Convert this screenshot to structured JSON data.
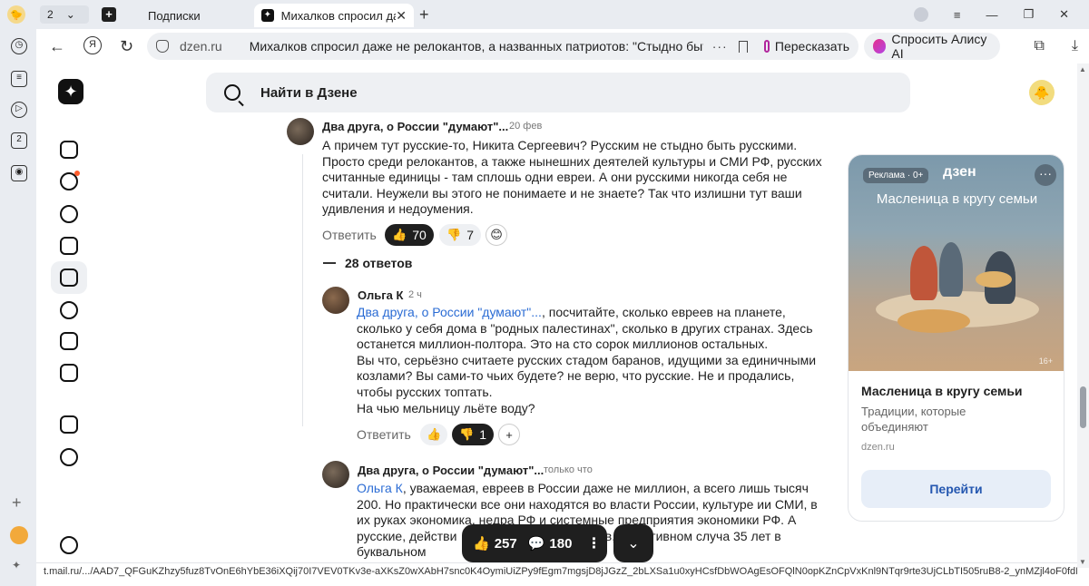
{
  "browser": {
    "tab_count": "2",
    "tabs": [
      {
        "label": "Подписки"
      },
      {
        "label": "Михалков спросил даже"
      }
    ],
    "address": {
      "domain": "dzen.ru",
      "page_title": "Михалков спросил даже не релокантов, а названных патриотов: \"Стыдно быт..."
    },
    "retell_label": "Пересказать",
    "alice_label": "Спросить Алису AI",
    "status_url": "t.mail.ru/.../AAD7_QFGuKZhzy5fuz8TvOnE6hYbE36iXQij70I7VEV0TKv3e-aXKsZ0wXAbH7snc0K4OymiUiZPy9fEgm7mgsjD8jJGzZ_2bLXSa1u0xyHCsfDbWOAgEsOFQlN0opKZnCpVxKnl9NTqr9rte3UjCLbTI505ruB8-2_ynMZjl4oF0fdI69jH7Vl..."
  },
  "header": {
    "search_label": "Найти в Дзене"
  },
  "comments": [
    {
      "author": "Два друга, о России \"думают\"...",
      "date": "20 фев",
      "text": "А причем тут русские-то, Никита Сергеевич? Русским не стыдно быть русскими. Просто среди релокантов, а также нынешних деятелей культуры и СМИ РФ, русских считанные единицы - там сплошь одни евреи. А они русскими никогда себя не считали. Неужели вы этого не понимаете и не знаете? Так что излишни тут ваши удивления и недоумения.",
      "reply_label": "Ответить",
      "likes": "70",
      "dislikes": "7",
      "replies_label": "28 ответов"
    },
    {
      "author": "Ольга К",
      "date": "2 ч",
      "mention": "Два друга, о России \"думают\"...",
      "text": ", посчитайте, сколько евреев на планете, сколько у себя дома в \"родных палестинах\", сколько в других странах. Здесь останется миллион-полтора. Это на сто сорок миллионов остальных.",
      "text2": "Вы что, серьёзно считаете русских стадом баранов, идущими за единичными козлами? Вы сами-то чьих будете? не верю, что русские. Не и продались, чтобы русских топтать.",
      "text3": "На чью мельницу льёте воду?",
      "reply_label": "Ответить",
      "dislikes": "1"
    },
    {
      "author": "Два друга, о России \"думают\"...",
      "date": "только что",
      "mention": "Ольга К",
      "text_a": ", уважаемая, евреев в России даже не миллион, а всего лишь тысяч 200. Но практически все они находятся во власти России, культуре ии СМИ, в их руках экономика, недра РФ и системные предприятия экономики РФ. А русские, действи",
      "text_b": "стоянии стада баранов, в противном случа",
      "text_c": "35 лет в буквальном"
    }
  ],
  "ad": {
    "badge": "Реклама · 0+",
    "brand": "дзен",
    "headline": "Масленица в кругу семьи",
    "age": "16+",
    "title": "Масленица в кругу семьи",
    "description": "Традиции, которые объединяют",
    "domain": "dzen.ru",
    "cta": "Перейти"
  },
  "action_bar": {
    "likes": "257",
    "comments": "180"
  }
}
